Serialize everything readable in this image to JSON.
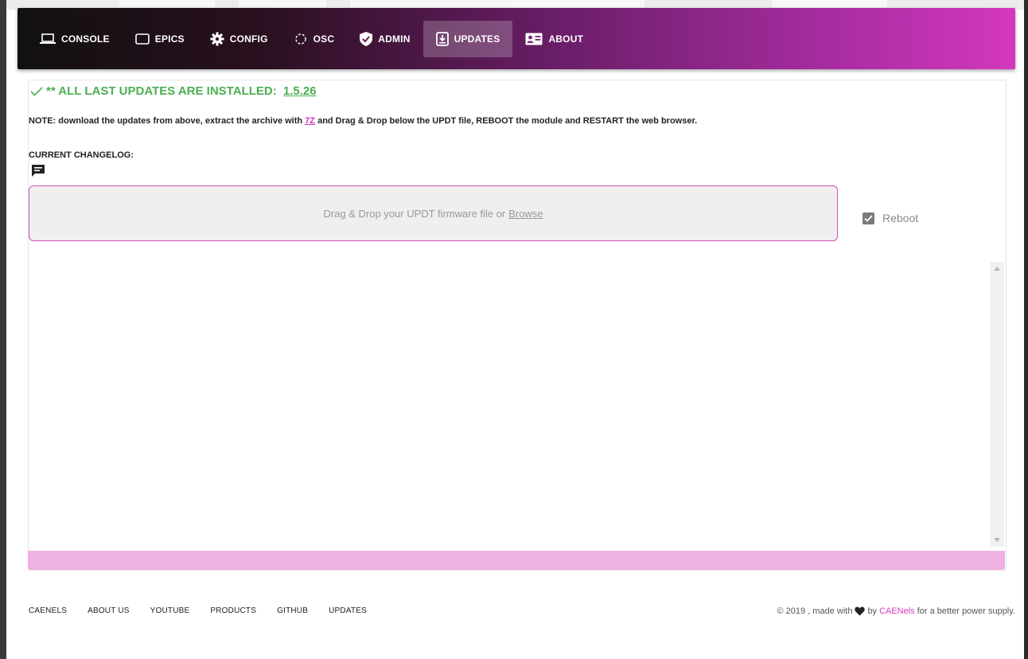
{
  "nav": {
    "items": [
      {
        "label": "CONSOLE",
        "icon": "laptop-icon"
      },
      {
        "label": "EPICS",
        "icon": "tablet-icon"
      },
      {
        "label": "CONFIG",
        "icon": "gear-icon"
      },
      {
        "label": "OSC",
        "icon": "oscilloscope-icon"
      },
      {
        "label": "ADMIN",
        "icon": "shield-check-icon"
      },
      {
        "label": "UPDATES",
        "icon": "download-box-icon"
      },
      {
        "label": "ABOUT",
        "icon": "id-card-icon"
      }
    ],
    "active": "UPDATES"
  },
  "status": {
    "prefix": "** ALL LAST UPDATES ARE INSTALLED: ",
    "version": "1.5.26",
    "icon": "check-icon",
    "color": "#4caf50"
  },
  "note": {
    "before": "NOTE: download the updates from above, extract the archive with ",
    "link": "7Z",
    "after": " and Drag & Drop below the UPDT file, REBOOT the module and RESTART the web browser."
  },
  "changelog": {
    "label": "CURRENT CHANGELOG:",
    "icon": "comment-icon"
  },
  "dropzone": {
    "text": "Drag & Drop your UPDT firmware file or",
    "browse": "Browse"
  },
  "reboot": {
    "label": "Reboot",
    "checked": true
  },
  "footer": {
    "links": [
      "CAENELS",
      "ABOUT US",
      "YOUTUBE",
      "PRODUCTS",
      "GITHUB",
      "UPDATES"
    ],
    "copyright_prefix": "© 2019 , made with",
    "by": "by",
    "brand": "CAENels",
    "suffix": "for a better power supply."
  },
  "colors": {
    "accent": "#d43cc0",
    "progress": "#efb0e2",
    "success": "#4caf50"
  }
}
